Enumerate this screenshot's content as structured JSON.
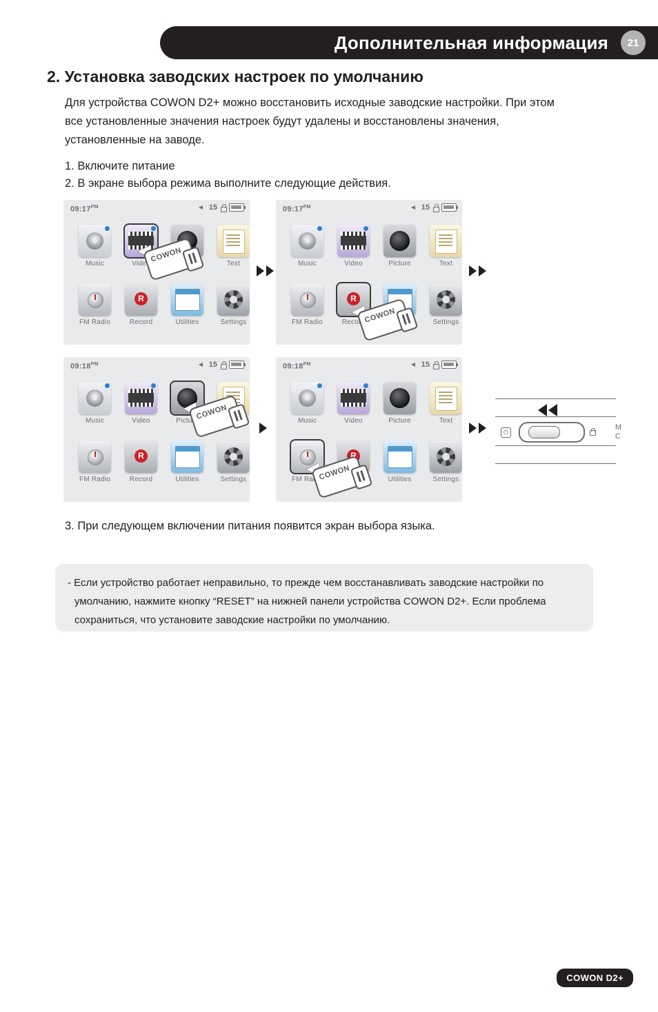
{
  "header": {
    "title": "Дополнительная информация",
    "page_number": "21"
  },
  "section": {
    "title": "2. Установка заводских настроек по умолчанию",
    "intro": "Для устройства COWON D2+ можно восстановить исходные заводские настройки. При этом все установленные значения настроек будут удалены и восстановлены значения, установленные на заводе.",
    "step1": "1. Включите питание",
    "step2": "2. В экране выбора режима выполните следующие действия.",
    "step3": "3. При следующем включении питания появится экран выбора языка."
  },
  "note": {
    "line1": "- Если устройство работает неправильно, то прежде чем восстанавливать заводские настройки по",
    "line2": "умолчанию, нажмите кнопку “RESET” на нижней панели устройства COWON D2+. Если проблема",
    "line3": "сохраниться, что установите заводские настройки по умолчанию."
  },
  "devices": [
    {
      "time": "09:17",
      "meridiem": "PM",
      "volume": "15",
      "selected": "Video",
      "stylus_label": "COWON"
    },
    {
      "time": "09:17",
      "meridiem": "PM",
      "volume": "15",
      "selected": "Record",
      "stylus_label": "COWON"
    },
    {
      "time": "09:18",
      "meridiem": "PM",
      "volume": "15",
      "selected": "Picture",
      "stylus_label": "COWON"
    },
    {
      "time": "09:18",
      "meridiem": "PM",
      "volume": "15",
      "selected": "FM Radio",
      "stylus_label": "COWON"
    }
  ],
  "menu_labels": {
    "music": "Music",
    "video": "Video",
    "picture": "Picture",
    "text": "Text",
    "fm_radio": "FM Radio",
    "record": "Record",
    "utilities": "Utilities",
    "settings": "Settings"
  },
  "device_bottom": {
    "power_icon": "power-icon",
    "lock_icon": "lock-icon",
    "edge_label_1": "M",
    "edge_label_2": "C"
  },
  "footer": {
    "product": "COWON D2+"
  }
}
